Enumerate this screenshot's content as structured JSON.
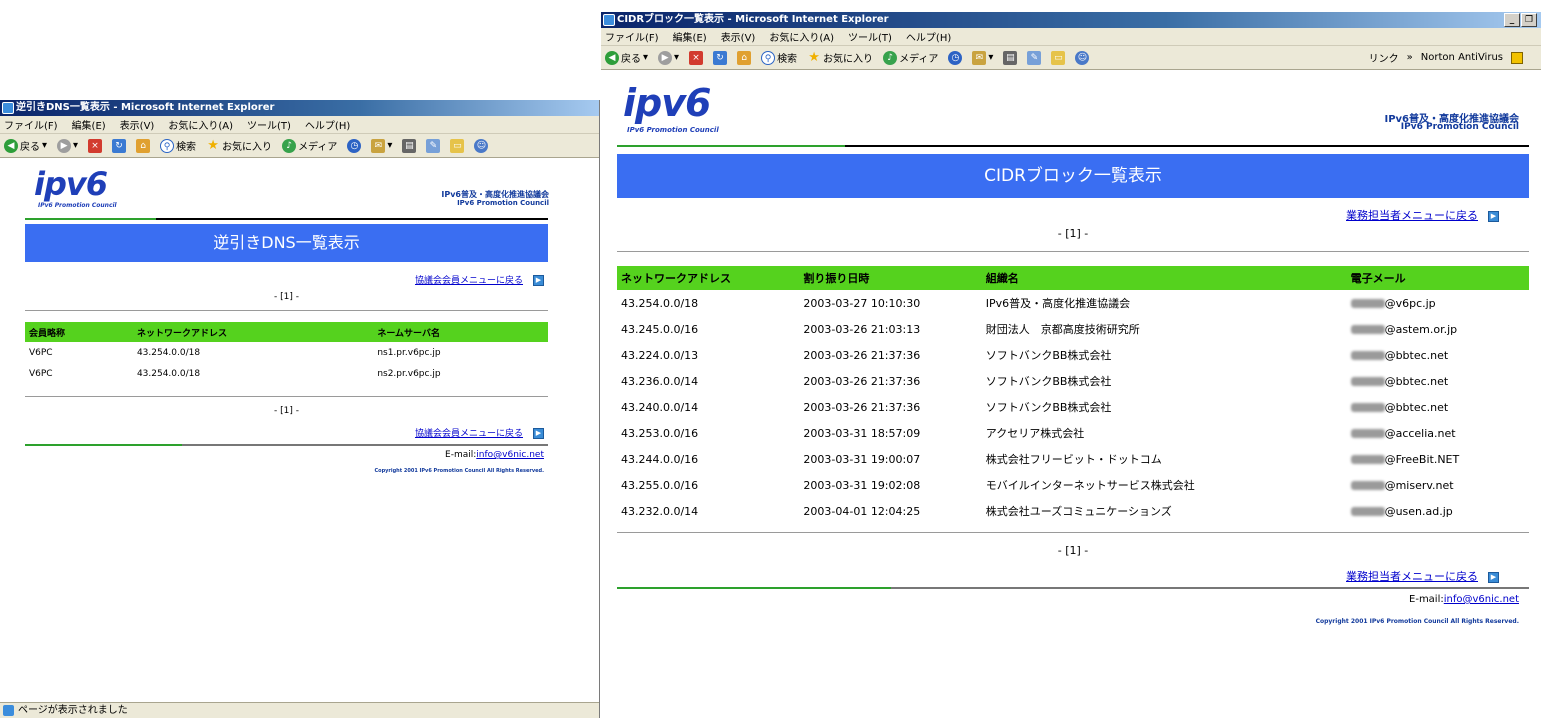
{
  "left_window": {
    "title": "逆引きDNS一覧表示 - Microsoft Internet Explorer",
    "menu": [
      "ファイル(F)",
      "編集(E)",
      "表示(V)",
      "お気に入り(A)",
      "ツール(T)",
      "ヘルプ(H)"
    ],
    "toolbar": {
      "back": "戻る",
      "search": "検索",
      "favorites": "お気に入り",
      "media": "メディア"
    },
    "page": {
      "logo_text": "ipv6",
      "logo_sub": "IPv6 Promotion Council",
      "org_ja": "IPv6普及・高度化推進協議会",
      "org_en": "IPv6 Promotion Council",
      "banner": "逆引きDNS一覧表示",
      "back_link": "協議会会員メニューに戻る",
      "pager": "- [1] -",
      "columns": [
        "会員略称",
        "ネットワークアドレス",
        "ネームサーバ名"
      ],
      "rows": [
        [
          "V6PC",
          "43.254.0.0/18",
          "ns1.pr.v6pc.jp"
        ],
        [
          "V6PC",
          "43.254.0.0/18",
          "ns2.pr.v6pc.jp"
        ]
      ],
      "email_label": "E-mail:",
      "email": "info@v6nic.net",
      "copyright": "Copyright 2001 IPv6 Promotion Council All Rights Reserved."
    },
    "status": "ページが表示されました"
  },
  "right_window": {
    "title": "CIDRブロック一覧表示 - Microsoft Internet Explorer",
    "menu": [
      "ファイル(F)",
      "編集(E)",
      "表示(V)",
      "お気に入り(A)",
      "ツール(T)",
      "ヘルプ(H)"
    ],
    "toolbar": {
      "back": "戻る",
      "search": "検索",
      "favorites": "お気に入り",
      "media": "メディア",
      "links": "リンク",
      "links_chevron": "»",
      "norton": "Norton AntiVirus"
    },
    "page": {
      "logo_text": "ipv6",
      "logo_sub": "IPv6 Promotion Council",
      "org_ja": "IPv6普及・高度化推進協議会",
      "org_en": "IPv6 Promotion Council",
      "banner": "CIDRブロック一覧表示",
      "back_link": "業務担当者メニューに戻る",
      "pager": "- [1] -",
      "columns": [
        "ネットワークアドレス",
        "割り振り日時",
        "組織名",
        "電子メール"
      ],
      "rows": [
        {
          "net": "43.254.0.0/18",
          "date": "2003-03-27 10:10:30",
          "org": "IPv6普及・高度化推進協議会",
          "mail": "@v6pc.jp"
        },
        {
          "net": "43.245.0.0/16",
          "date": "2003-03-26 21:03:13",
          "org": "財団法人　京都高度技術研究所",
          "mail": "@astem.or.jp"
        },
        {
          "net": "43.224.0.0/13",
          "date": "2003-03-26 21:37:36",
          "org": "ソフトバンクBB株式会社",
          "mail": "@bbtec.net"
        },
        {
          "net": "43.236.0.0/14",
          "date": "2003-03-26 21:37:36",
          "org": "ソフトバンクBB株式会社",
          "mail": "@bbtec.net"
        },
        {
          "net": "43.240.0.0/14",
          "date": "2003-03-26 21:37:36",
          "org": "ソフトバンクBB株式会社",
          "mail": "@bbtec.net"
        },
        {
          "net": "43.253.0.0/16",
          "date": "2003-03-31 18:57:09",
          "org": "アクセリア株式会社",
          "mail": "@accelia.net"
        },
        {
          "net": "43.244.0.0/16",
          "date": "2003-03-31 19:00:07",
          "org": "株式会社フリービット・ドットコム",
          "mail": "@FreeBit.NET"
        },
        {
          "net": "43.255.0.0/16",
          "date": "2003-03-31 19:02:08",
          "org": "モバイルインターネットサービス株式会社",
          "mail": "@miserv.net"
        },
        {
          "net": "43.232.0.0/14",
          "date": "2003-04-01 12:04:25",
          "org": "株式会社ユーズコミュニケーションズ",
          "mail": "@usen.ad.jp"
        }
      ],
      "email_label": "E-mail:",
      "email": "info@v6nic.net",
      "copyright": "Copyright 2001 IPv6 Promotion Council All Rights Reserved."
    }
  },
  "colors": {
    "banner": "#3a6ef2",
    "table_header": "#55d21e",
    "link": "#0000cc",
    "org_text": "#123a9c"
  }
}
